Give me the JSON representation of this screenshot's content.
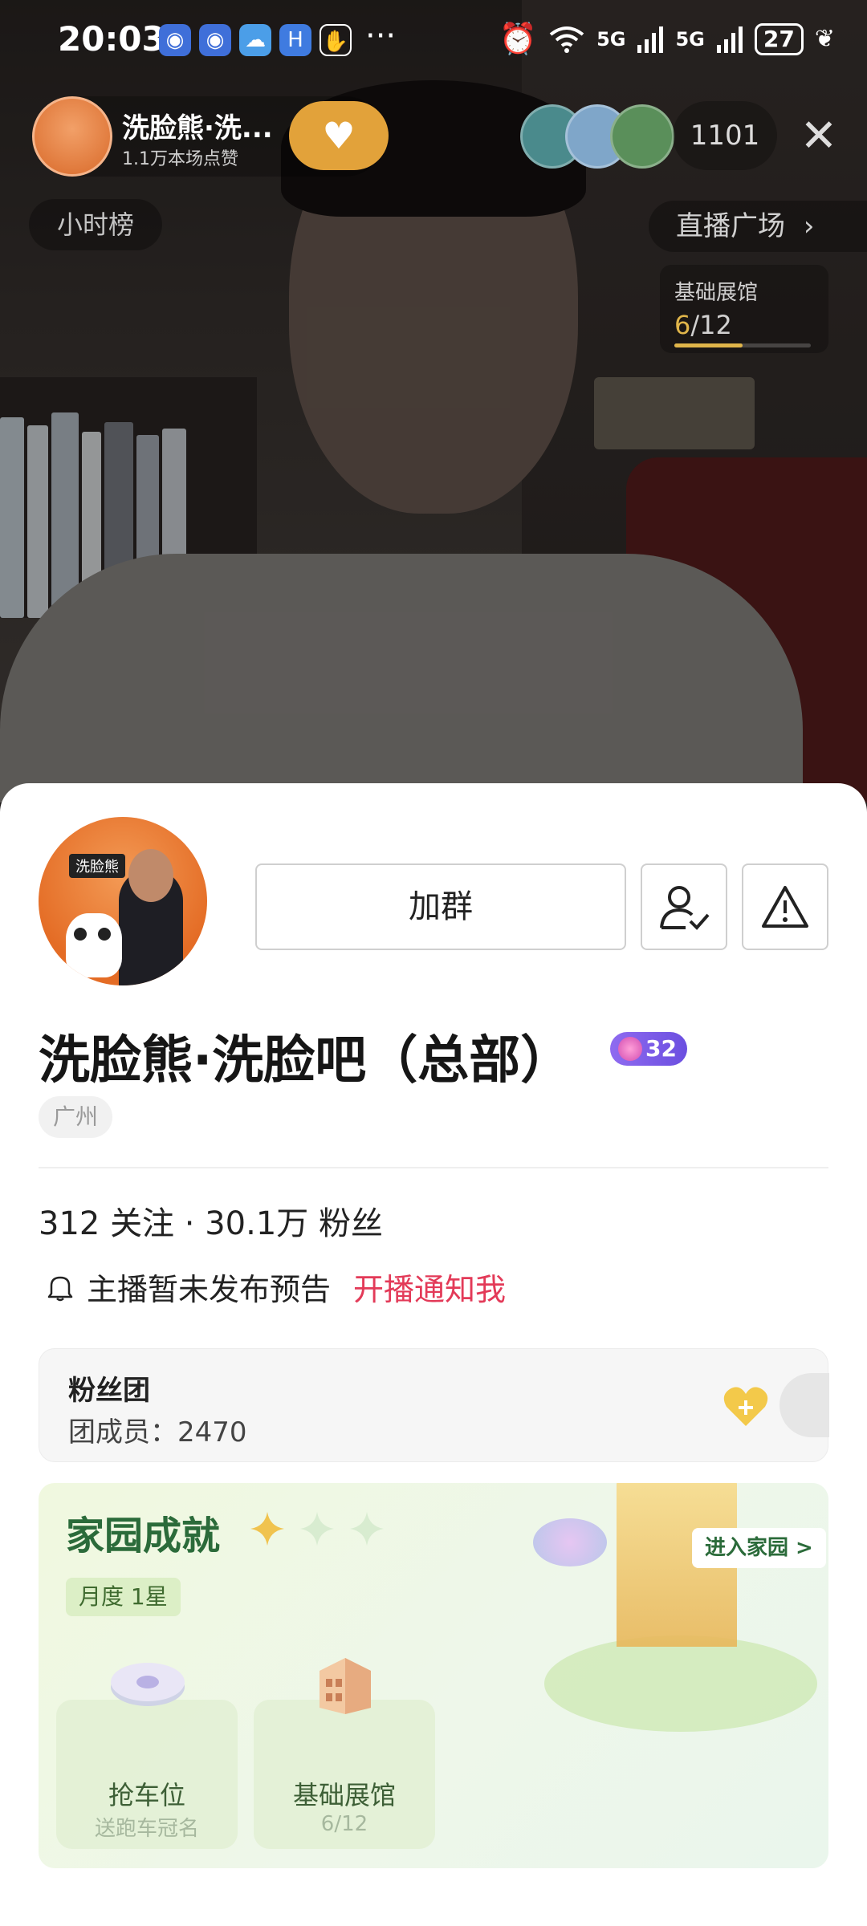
{
  "status_bar": {
    "time": "20:03",
    "more": "···",
    "signal1": "5G",
    "signal2": "5G",
    "battery": "27"
  },
  "live": {
    "host_short_name": "洗脸熊·洗...",
    "likes": "1.1万本场点赞",
    "viewer_count": "1101",
    "hourly_rank": "小时榜",
    "live_plaza": "直播广场",
    "gallery": {
      "title": "基础展馆",
      "current": "6",
      "total": "/12",
      "progress": 0.5
    }
  },
  "profile": {
    "name": "洗脸熊·洗脸吧（总部）",
    "level": "32",
    "location": "广州",
    "stats": "312 关注 · 30.1万 粉丝",
    "notice": "主播暂未发布预告",
    "notice_link": "开播通知我",
    "join_group": "加群",
    "avatar_logo": "洗脸熊"
  },
  "fan_club": {
    "title": "粉丝团",
    "members": "团成员：2470"
  },
  "home": {
    "title": "家园成就",
    "month_tag": "月度 1星",
    "enter": "进入家园 >",
    "tiles": [
      {
        "label": "抢车位",
        "sub": "送跑车冠名"
      },
      {
        "label": "基础展馆",
        "sub": "6/12"
      }
    ]
  },
  "colors": {
    "accent_red": "#e33a58",
    "home_green": "#2b6b3a",
    "gold": "#e0b54a",
    "level_purple": "#7a5ae8"
  }
}
